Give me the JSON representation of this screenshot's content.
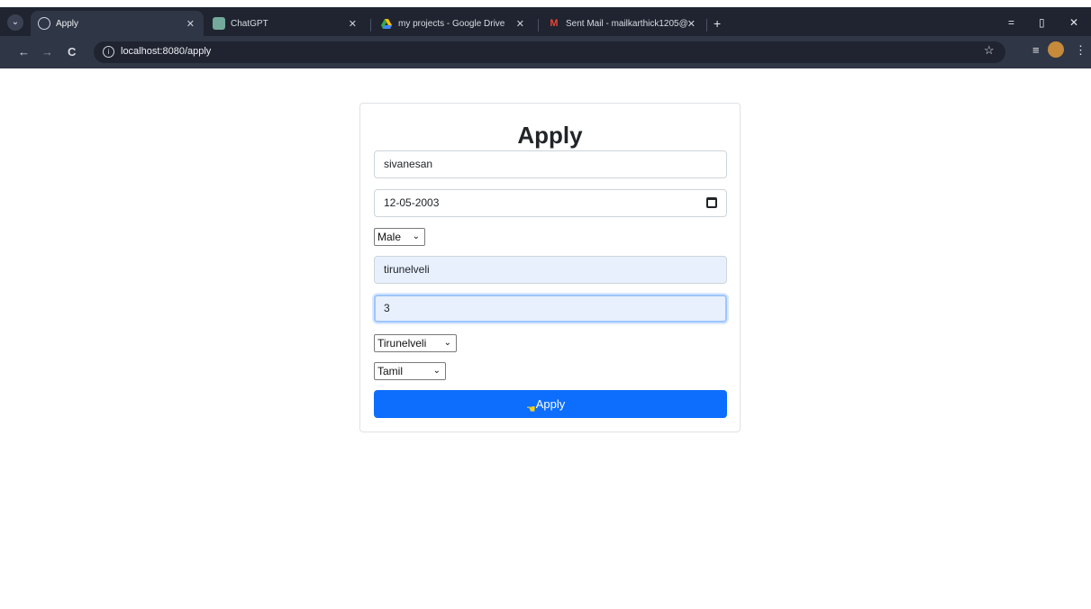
{
  "browser": {
    "tabs": [
      {
        "title": "Apply",
        "active": true
      },
      {
        "title": "ChatGPT",
        "active": false
      },
      {
        "title": "my projects - Google Drive",
        "active": false
      },
      {
        "title": "Sent Mail - mailkarthick1205@",
        "active": false
      }
    ],
    "url": "localhost:8080/apply",
    "icons": {
      "tab_menu": "chevron-down-icon",
      "new_tab": "+",
      "back": "←",
      "forward": "→",
      "reload": "C",
      "star": "☆"
    }
  },
  "form": {
    "title": "Apply",
    "name_value": "sivanesan",
    "dob_value": "12-05-2003",
    "gender_selected": "Male",
    "city_value": "tirunelveli",
    "number_value": "3",
    "district_selected": "Tirunelveli",
    "language_selected": "Tamil",
    "submit_label": "Apply"
  },
  "colors": {
    "primary": "#0d6efd",
    "autofill": "#e8f0fe",
    "chrome_dark": "#1f2430"
  }
}
